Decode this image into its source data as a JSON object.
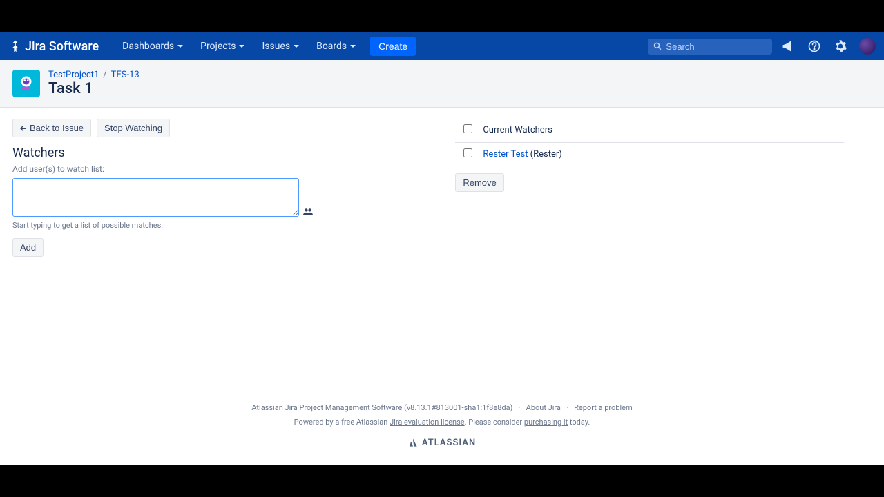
{
  "brand": "Jira Software",
  "nav": {
    "items": [
      "Dashboards",
      "Projects",
      "Issues",
      "Boards"
    ],
    "create": "Create",
    "search_placeholder": "Search"
  },
  "header": {
    "breadcrumb": {
      "project": "TestProject1",
      "issue_key": "TES-13"
    },
    "title": "Task 1"
  },
  "actions": {
    "back": "Back to Issue",
    "stop_watching": "Stop Watching"
  },
  "watchers": {
    "heading": "Watchers",
    "add_label": "Add user(s) to watch list:",
    "hint": "Start typing to get a list of possible matches.",
    "add_button": "Add",
    "table_header": "Current Watchers",
    "rows": [
      {
        "display_name": "Rester Test",
        "username_suffix": " (Rester)"
      }
    ],
    "remove_button": "Remove"
  },
  "footer": {
    "line1_prefix": "Atlassian Jira ",
    "line1_link1": "Project Management Software",
    "line1_version": " (v8.13.1#813001-sha1:1f8e8da)",
    "about": "About Jira",
    "report": "Report a problem",
    "line2_prefix": "Powered by a free Atlassian ",
    "line2_link": "Jira evaluation license",
    "line2_mid": ". Please consider ",
    "line2_link2": "purchasing it",
    "line2_suffix": " today.",
    "logo": "ATLASSIAN"
  }
}
